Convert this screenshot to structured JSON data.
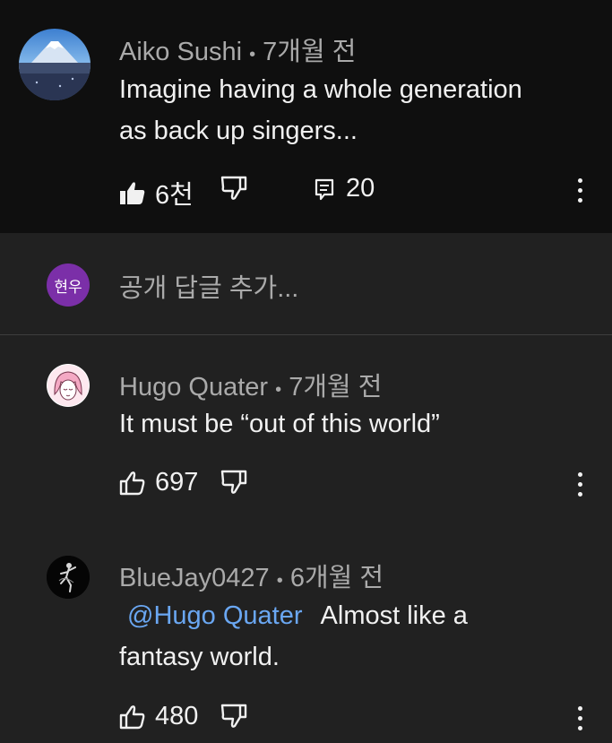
{
  "comments": [
    {
      "author": "Aiko Sushi",
      "age": "7개월 전",
      "text_line1": "Imagine having a whole generation",
      "text_line2": "as back up singers...",
      "likes": "6천",
      "replies": "20"
    },
    {
      "author": "Hugo Quater",
      "age": "7개월 전",
      "text": "It must be “out of this world”",
      "likes": "697"
    },
    {
      "author": "BlueJay0427",
      "age": "6개월 전",
      "mention": "@Hugo Quater",
      "text_line1": "Almost like a",
      "text_line2": "fantasy world.",
      "likes": "480"
    }
  ],
  "reply_box": {
    "avatar_label": "현우",
    "placeholder": "공개 답글 추가..."
  },
  "separator": "•",
  "colors": {
    "background": "#212121",
    "top_background": "#0f0f0f",
    "mention": "#6aa7f2",
    "avatar_purple": "#7b2fa8"
  }
}
